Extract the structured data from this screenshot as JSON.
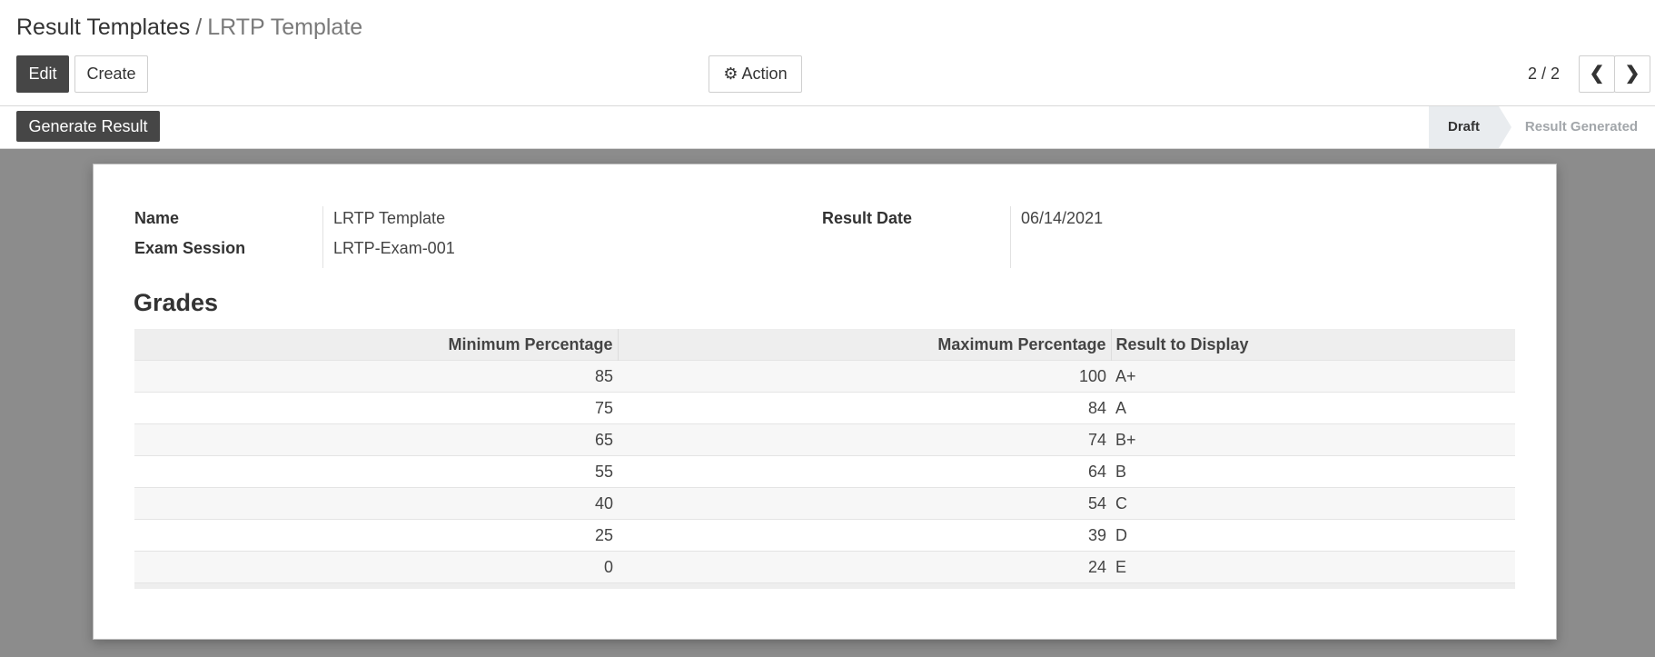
{
  "breadcrumb": {
    "parent": "Result Templates",
    "separator": "/",
    "current": "LRTP Template"
  },
  "toolbar": {
    "edit_label": "Edit",
    "create_label": "Create",
    "action_label": "Action"
  },
  "pager": {
    "value": "2 / 2"
  },
  "statusbar": {
    "generate_label": "Generate Result",
    "stages": [
      "Draft",
      "Result Generated"
    ],
    "active_stage": "Draft"
  },
  "form": {
    "name_label": "Name",
    "name_value": "LRTP Template",
    "exam_label": "Exam Session",
    "exam_value": "LRTP-Exam-001",
    "date_label": "Result Date",
    "date_value": "06/14/2021"
  },
  "grades": {
    "title": "Grades",
    "columns": [
      "Minimum Percentage",
      "Maximum Percentage",
      "Result to Display"
    ],
    "rows": [
      {
        "min": "85",
        "max": "100",
        "result": "A+"
      },
      {
        "min": "75",
        "max": "84",
        "result": "A"
      },
      {
        "min": "65",
        "max": "74",
        "result": "B+"
      },
      {
        "min": "55",
        "max": "64",
        "result": "B"
      },
      {
        "min": "40",
        "max": "54",
        "result": "C"
      },
      {
        "min": "25",
        "max": "39",
        "result": "D"
      },
      {
        "min": "0",
        "max": "24",
        "result": "E"
      }
    ]
  },
  "icons": {
    "action": "gear-icon",
    "prev": "chevron-left-icon",
    "next": "chevron-right-icon"
  },
  "colors": {
    "primary_button": "#464646",
    "background": "#8c8c8c",
    "sheet": "#ffffff"
  }
}
